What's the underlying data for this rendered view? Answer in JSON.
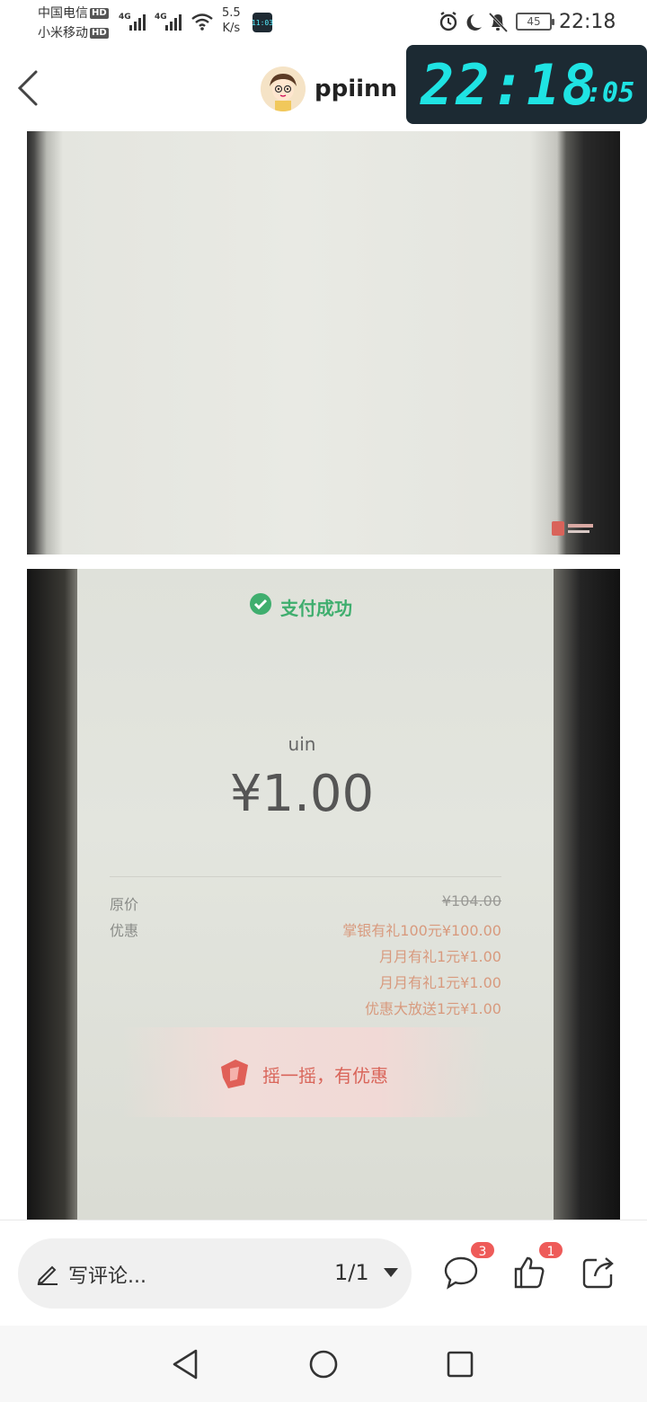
{
  "status_bar": {
    "carrier1": "中国电信",
    "carrier2": "小米移动",
    "hd_label": "HD",
    "network_type": "4G",
    "net_speed_value": "5.5",
    "net_speed_unit": "K/s",
    "mini_app_text": "11:03",
    "battery": "45",
    "time": "22:18",
    "icons": [
      "alarm-icon",
      "moon-icon",
      "bell-off-icon",
      "battery-icon",
      "wifi-icon",
      "signal-icon"
    ]
  },
  "header": {
    "username": "ppiinn",
    "clock_widget": {
      "hours_minutes": "22:18",
      "seconds": ":05"
    }
  },
  "receipt": {
    "status": "支付成功",
    "merchant": "uin",
    "amount": "¥1.00",
    "labels": {
      "original": "原价",
      "discount": "优惠"
    },
    "original_price": "¥104.00",
    "discounts": [
      "掌银有礼100元¥100.00",
      "月月有礼1元¥1.00",
      "月月有礼1元¥1.00",
      "优惠大放送1元¥1.00"
    ],
    "shake_text": "摇一摇，有优惠"
  },
  "action_bar": {
    "comment_placeholder": "写评论...",
    "page_count": "1/1",
    "comments_badge": "3",
    "likes_badge": "1"
  },
  "colors": {
    "clock_digits": "#1fe3e3",
    "clock_bg": "#1c2a33",
    "success_green": "#3fae6e",
    "discount_text": "#d89a7e",
    "badge_red": "#ee5b59"
  }
}
